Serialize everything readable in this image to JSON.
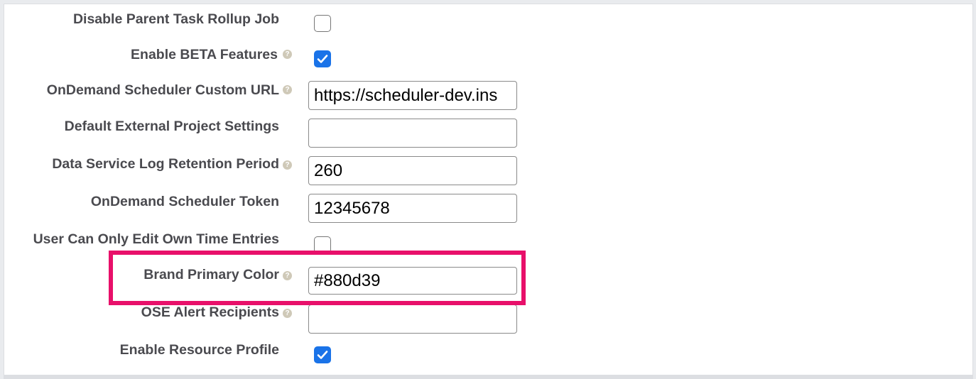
{
  "settings": {
    "rows": [
      {
        "label": "Disable Parent Task Rollup Job",
        "type": "checkbox",
        "checked": false,
        "help": false
      },
      {
        "label": "Enable BETA Features",
        "type": "checkbox",
        "checked": true,
        "help": true
      },
      {
        "label": "OnDemand Scheduler Custom URL",
        "type": "text",
        "value": "https://scheduler-dev.ins",
        "help": true
      },
      {
        "label": "Default External Project Settings",
        "type": "text",
        "value": "",
        "help": false
      },
      {
        "label": "Data Service Log Retention Period",
        "type": "text",
        "value": "260",
        "help": true
      },
      {
        "label": "OnDemand Scheduler Token",
        "type": "text",
        "value": "12345678",
        "help": false
      },
      {
        "label": "User Can Only Edit Own Time Entries",
        "type": "checkbox",
        "checked": false,
        "help": false
      },
      {
        "label": "Brand Primary Color",
        "type": "text",
        "value": "#880d39",
        "help": true
      },
      {
        "label": "OSE Alert Recipients",
        "type": "text",
        "value": "",
        "help": true
      },
      {
        "label": "Enable Resource Profile",
        "type": "checkbox",
        "checked": true,
        "help": false
      }
    ]
  },
  "help_icon_glyph": "?",
  "colors": {
    "highlight": "#e8106a",
    "checkbox_checked": "#1a73e8",
    "label_text": "#4a4a4f"
  },
  "icons": {
    "help": "help-icon",
    "check": "checkmark-icon"
  }
}
